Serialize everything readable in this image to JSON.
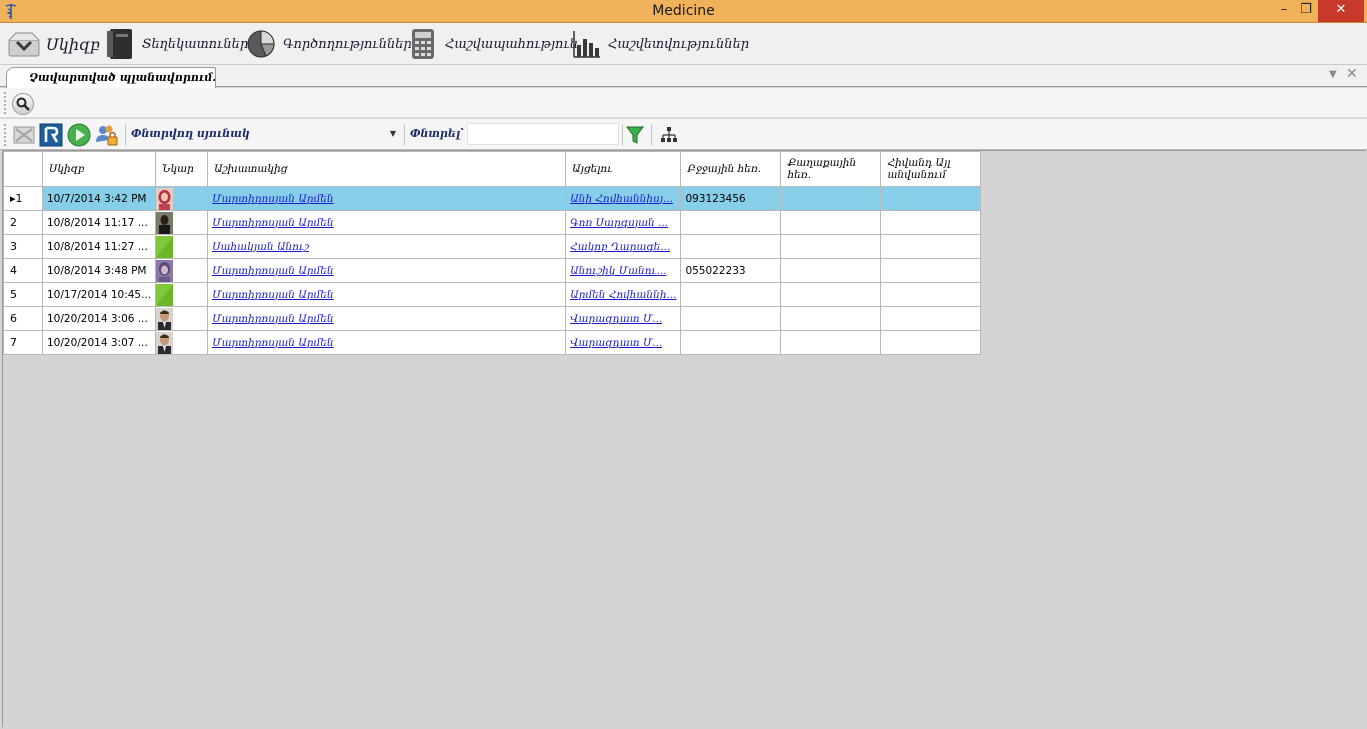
{
  "window": {
    "title": "Medicine"
  },
  "ribbon": {
    "items": [
      {
        "label": "Սկիզբ",
        "icon": "inbox-icon"
      },
      {
        "label": "Տեղեկատուներ",
        "icon": "book-icon"
      },
      {
        "label": "Գործողություններ",
        "icon": "pie-chart-icon"
      },
      {
        "label": "Հաշվապահություն",
        "icon": "calculator-icon"
      },
      {
        "label": "Հաշվետվություններ",
        "icon": "bar-chart-icon"
      }
    ]
  },
  "tab": {
    "label": "Չավարտված պլանավորում..."
  },
  "toolbar": {
    "search_column_label": "Փնտրվող սյունակ՝",
    "search_column_value": "",
    "search_label": "Փնտրել՝",
    "search_value": ""
  },
  "grid": {
    "columns": [
      "",
      "Սկիզբ",
      "Նկար",
      "Աշխատակից",
      "Այցելու",
      "Բջջային հեռ.",
      "Քաղաքային հեռ.",
      "Հիվանդ Այլ անվանում"
    ],
    "rows": [
      {
        "num": "1",
        "start": "10/7/2014 3:42 PM",
        "photo": "woman-red-photo",
        "employee": "Մարտիրոսյան Արմեն",
        "visitor": "Անի Հովհաննիսյ...",
        "mobile": "093123456",
        "city": "",
        "other": "",
        "selected": true
      },
      {
        "num": "2",
        "start": "10/8/2014 11:17 ...",
        "photo": "dark-person-photo",
        "employee": "Մարտիրոսյան Արմեն",
        "visitor": "Գոռ Սարգսյան ...",
        "mobile": "",
        "city": "",
        "other": ""
      },
      {
        "num": "3",
        "start": "10/8/2014 11:27 ...",
        "photo": "green-placeholder-photo",
        "employee": "Սահակյան Անուշ",
        "visitor": "Հակոբ Ղարագե...",
        "mobile": "",
        "city": "",
        "other": ""
      },
      {
        "num": "4",
        "start": "10/8/2014 3:48 PM",
        "photo": "woman-purple-photo",
        "employee": "Մարտիրոսյան Արմեն",
        "visitor": "Անուշիկ Մանու...",
        "mobile": "055022233",
        "city": "",
        "other": ""
      },
      {
        "num": "5",
        "start": "10/17/2014 10:45...",
        "photo": "green-placeholder-photo",
        "employee": "Մարտիրոսյան Արմեն",
        "visitor": "Արմեն Հովհաննի...",
        "mobile": "",
        "city": "",
        "other": ""
      },
      {
        "num": "6",
        "start": "10/20/2014 3:06 ...",
        "photo": "man-suit-photo",
        "employee": "Մարտիրոսյան Արմեն",
        "visitor": "Վարազդատ Մ...",
        "mobile": "",
        "city": "",
        "other": ""
      },
      {
        "num": "7",
        "start": "10/20/2014 3:07 ...",
        "photo": "man-suit-photo",
        "employee": "Մարտիրոսյան Արմեն",
        "visitor": "Վարազդատ Մ...",
        "mobile": "",
        "city": "",
        "other": ""
      }
    ]
  },
  "colors": {
    "titlebar": "#efb25b",
    "selection": "#87cee8",
    "link": "#1a1acc",
    "close": "#c7392b"
  }
}
